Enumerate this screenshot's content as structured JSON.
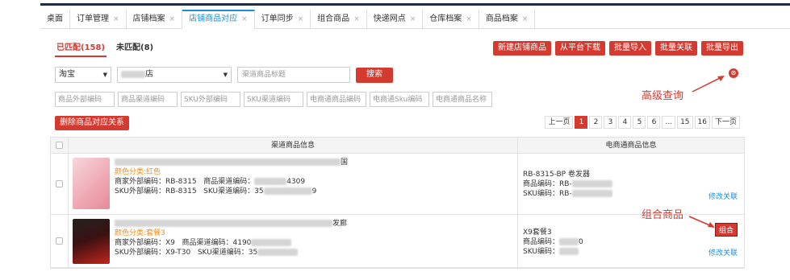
{
  "tabs": [
    {
      "label": "桌面",
      "closable": false,
      "active": false
    },
    {
      "label": "订单管理",
      "closable": true,
      "active": false
    },
    {
      "label": "店铺档案",
      "closable": true,
      "active": false
    },
    {
      "label": "店铺商品对应",
      "closable": true,
      "active": true
    },
    {
      "label": "订单同步",
      "closable": true,
      "active": false
    },
    {
      "label": "组合商品",
      "closable": true,
      "active": false
    },
    {
      "label": "快递网点",
      "closable": true,
      "active": false
    },
    {
      "label": "仓库档案",
      "closable": true,
      "active": false
    },
    {
      "label": "商品档案",
      "closable": true,
      "active": false
    }
  ],
  "close_glyph": "×",
  "subtabs": {
    "matched": "已匹配(158)",
    "unmatched": "未匹配(8)"
  },
  "actions": {
    "new_store_product": "新建店铺商品",
    "download_platform": "从平台下载",
    "batch_import": "批量导入",
    "batch_link": "批量关联",
    "batch_export": "批量导出"
  },
  "filters": {
    "platform": "淘宝",
    "store": "店",
    "channel_title_placeholder": "渠道商品标题",
    "search_label": "搜索",
    "fields": [
      "商品外部编码",
      "商品渠道编码",
      "SKU外部编码",
      "SKU渠道编码",
      "电商通商品编码",
      "电商通Sku编码",
      "电商通商品名称"
    ]
  },
  "delete_label": "删除商品对应关系",
  "pagination": {
    "prev": "上一页",
    "pages": [
      "1",
      "2",
      "3",
      "4",
      "5",
      "6",
      "...",
      "15",
      "16"
    ],
    "current": "1",
    "next": "下一页"
  },
  "annotations": {
    "advanced_query": "高级查询",
    "combo_product": "组合商品"
  },
  "advanced_icon": "advanced-query-icon",
  "table": {
    "headers": {
      "channel": "渠道商品信息",
      "ecom": "电商通商品信息"
    },
    "rows": [
      {
        "title_prefix": "",
        "title_suffix": "国",
        "variant": "颜色分类:红色",
        "merchant_code": "商家外部编码：RB-8315",
        "channel_code": "商品渠道编码：",
        "channel_code_tail": "4309",
        "sku_ext": "SKU外部编码：RB-8315",
        "sku_channel": "SKU渠道编码：35",
        "sku_channel_tail": "9",
        "ec_name": "RB-8315-BP 卷发器",
        "ec_code": "商品编码：RB-",
        "ec_sku": "SKU编码：RB-",
        "action": "修改关联",
        "badge": ""
      },
      {
        "title_prefix": "",
        "title_suffix": "发廊",
        "variant": "颜色分类:套餐3",
        "merchant_code": "商家外部编码：X9",
        "channel_code": "商品渠道编码：4190",
        "channel_code_tail": "",
        "sku_ext": "SKU外部编码：X9-T30",
        "sku_channel": "SKU渠道编码：35",
        "sku_channel_tail": "",
        "ec_name": "X9套餐3",
        "ec_code": "商品编码：",
        "ec_code_tail": "0",
        "ec_sku": "SKU编码：",
        "action": "修改关联",
        "badge": "组合"
      }
    ]
  },
  "colors": {
    "accent": "#d43a2f",
    "link": "#1a8fd8",
    "variant": "#f08c1a"
  }
}
